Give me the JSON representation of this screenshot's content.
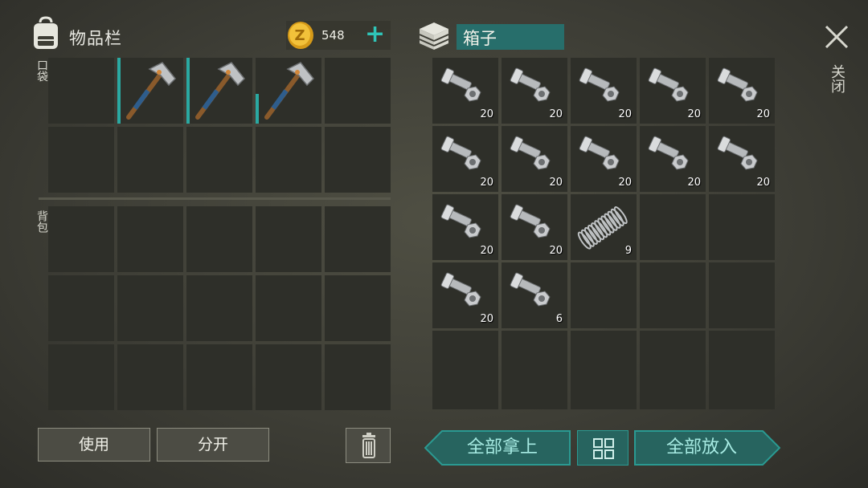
{
  "inventory": {
    "title": "物品栏",
    "pocket_label": "口袋",
    "backpack_label": "背包",
    "coins": "548",
    "add_symbol": "+",
    "pocket_slots": [
      {
        "item": "",
        "fill": 0
      },
      {
        "item": "pickaxe",
        "fill": 1.0
      },
      {
        "item": "pickaxe",
        "fill": 1.0
      },
      {
        "item": "pickaxe",
        "fill": 0.45
      },
      {
        "item": "",
        "fill": 0
      },
      {
        "item": "",
        "fill": 0
      },
      {
        "item": "",
        "fill": 0
      },
      {
        "item": "",
        "fill": 0
      },
      {
        "item": "",
        "fill": 0
      },
      {
        "item": "",
        "fill": 0
      }
    ],
    "backpack_rows": 3
  },
  "box": {
    "title": "箱子",
    "slots": [
      {
        "item": "bolt-nut",
        "qty": "20"
      },
      {
        "item": "bolt-nut",
        "qty": "20"
      },
      {
        "item": "bolt-nut",
        "qty": "20"
      },
      {
        "item": "bolt-nut",
        "qty": "20"
      },
      {
        "item": "bolt-nut",
        "qty": "20"
      },
      {
        "item": "bolt-nut",
        "qty": "20"
      },
      {
        "item": "bolt-nut",
        "qty": "20"
      },
      {
        "item": "bolt-nut",
        "qty": "20"
      },
      {
        "item": "bolt-nut",
        "qty": "20"
      },
      {
        "item": "bolt-nut",
        "qty": "20"
      },
      {
        "item": "bolt-nut",
        "qty": "20"
      },
      {
        "item": "bolt-nut",
        "qty": "20"
      },
      {
        "item": "spring",
        "qty": "9"
      },
      {
        "item": "",
        "qty": ""
      },
      {
        "item": "",
        "qty": ""
      },
      {
        "item": "bolt-nut",
        "qty": "20"
      },
      {
        "item": "bolt-nut",
        "qty": "6"
      },
      {
        "item": "",
        "qty": ""
      },
      {
        "item": "",
        "qty": ""
      },
      {
        "item": "",
        "qty": ""
      },
      {
        "item": "",
        "qty": ""
      },
      {
        "item": "",
        "qty": ""
      },
      {
        "item": "",
        "qty": ""
      },
      {
        "item": "",
        "qty": ""
      },
      {
        "item": "",
        "qty": ""
      }
    ]
  },
  "close_label": "关闭",
  "buttons": {
    "use": "使用",
    "split": "分开",
    "take_all": "全部拿上",
    "put_all": "全部放入"
  },
  "colors": {
    "accent_teal": "#2fc4b7",
    "slot_bg": "#2e2f29",
    "box_title_bg": "#276e6b"
  },
  "icons": [
    "backpack-icon",
    "coin-icon",
    "plus-icon",
    "box-icon",
    "close-icon",
    "trash-icon",
    "grid-icon",
    "pickaxe-icon",
    "bolt-nut-icon",
    "spring-icon"
  ]
}
